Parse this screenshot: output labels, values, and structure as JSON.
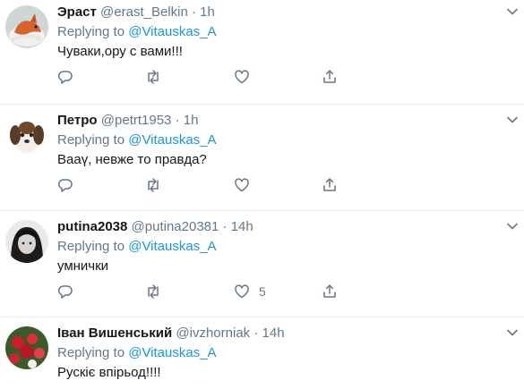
{
  "tweets": [
    {
      "name": "Эраст",
      "handle": "@erast_Belkin",
      "sep": "·",
      "time": "1h",
      "reply_prefix": "Replying to",
      "reply_to": "@Vitauskas_A",
      "text": "Чуваки,ору с вами!!!",
      "like_count": "",
      "avatar_icon": "fox-avatar"
    },
    {
      "name": "Петро",
      "handle": "@petrt1953",
      "sep": "·",
      "time": "1h",
      "reply_prefix": "Replying to",
      "reply_to": "@Vitauskas_A",
      "text": "Вааү, невже то правда?",
      "like_count": "",
      "avatar_icon": "puppy-avatar"
    },
    {
      "name": "putina2038",
      "handle": "@putina20381",
      "sep": "·",
      "time": "14h",
      "reply_prefix": "Replying to",
      "reply_to": "@Vitauskas_A",
      "text": "умнички",
      "like_count": "5",
      "avatar_icon": "portrait-avatar"
    },
    {
      "name": "Іван Вишенський",
      "handle": "@ivzhorniak",
      "sep": "·",
      "time": "14h",
      "reply_prefix": "Replying to",
      "reply_to": "@Vitauskas_A",
      "text": "Рускіє впірьод!!!!",
      "like_count": "",
      "avatar_icon": "flowers-avatar"
    }
  ],
  "colors": {
    "link": "#1b95e0",
    "muted": "#657786",
    "divider": "#e6ecf0"
  }
}
